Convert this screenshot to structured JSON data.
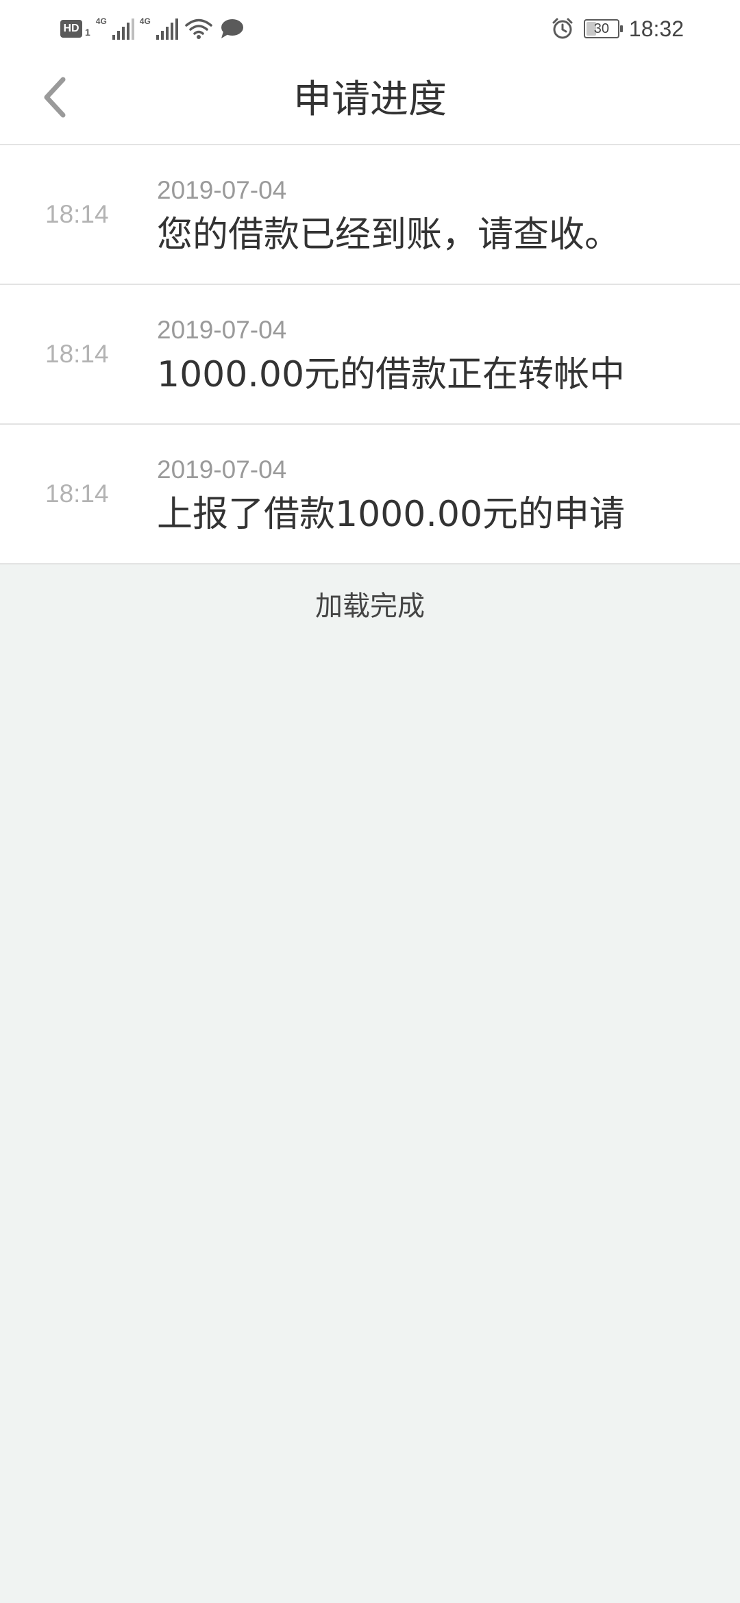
{
  "status_bar": {
    "left_icons": [
      "hd-icon",
      "sim1-icon",
      "signal-4g-icon",
      "signal-4g-icon",
      "wifi-icon",
      "message-icon"
    ],
    "hd_label": "HD",
    "sim_label": "1",
    "network_label": "4G",
    "alarm_icon": "alarm-icon",
    "battery_level": "30",
    "time": "18:32"
  },
  "header": {
    "title": "申请进度",
    "back_icon": "chevron-left-icon"
  },
  "timeline": [
    {
      "time": "18:14",
      "date": "2019-07-04",
      "message": "您的借款已经到账，请查收。"
    },
    {
      "time": "18:14",
      "date": "2019-07-04",
      "message": "1000.00元的借款正在转帐中"
    },
    {
      "time": "18:14",
      "date": "2019-07-04",
      "message": "上报了借款1000.00元的申请"
    }
  ],
  "footer": {
    "load_status": "加载完成"
  },
  "colors": {
    "background": "#f0f3f2",
    "card": "#ffffff",
    "divider": "#e3e3e3",
    "primary_text": "#333333",
    "secondary_text": "#9a9a9a",
    "muted_text": "#b3b3b3"
  }
}
